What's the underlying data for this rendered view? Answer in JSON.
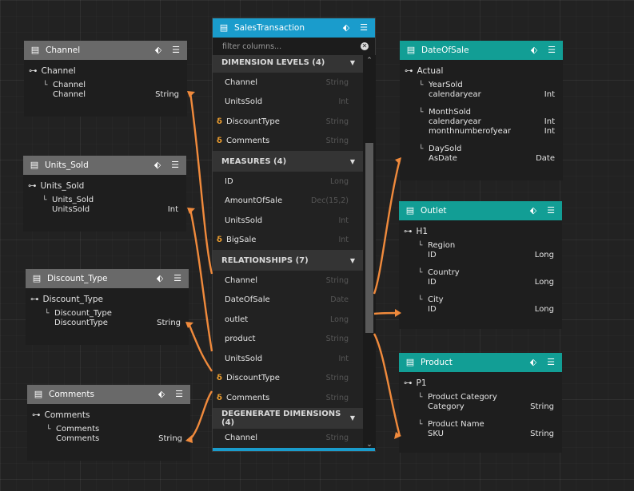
{
  "sales": {
    "title": "SalesTransaction",
    "filter_placeholder": "filter columns...",
    "sections": [
      {
        "title": "DIMENSION LEVELS (4)",
        "rows": [
          {
            "name": "Channel",
            "type": "String",
            "delta": false
          },
          {
            "name": "UnitsSold",
            "type": "Int",
            "delta": false
          },
          {
            "name": "DiscountType",
            "type": "String",
            "delta": true
          },
          {
            "name": "Comments",
            "type": "String",
            "delta": true
          }
        ]
      },
      {
        "title": "MEASURES (4)",
        "rows": [
          {
            "name": "ID",
            "type": "Long",
            "delta": false
          },
          {
            "name": "AmountOfSale",
            "type": "Dec(15,2)",
            "delta": false
          },
          {
            "name": "UnitsSold",
            "type": "Int",
            "delta": false
          },
          {
            "name": "BigSale",
            "type": "Int",
            "delta": true
          }
        ]
      },
      {
        "title": "RELATIONSHIPS (7)",
        "rows": [
          {
            "name": "Channel",
            "type": "String",
            "delta": false
          },
          {
            "name": "DateOfSale",
            "type": "Date",
            "delta": false
          },
          {
            "name": "outlet",
            "type": "Long",
            "delta": false
          },
          {
            "name": "product",
            "type": "String",
            "delta": false
          },
          {
            "name": "UnitsSold",
            "type": "Int",
            "delta": false
          },
          {
            "name": "DiscountType",
            "type": "String",
            "delta": true
          },
          {
            "name": "Comments",
            "type": "String",
            "delta": true
          }
        ]
      },
      {
        "title": "DEGENERATE DIMENSIONS (4)",
        "rows": [
          {
            "name": "Channel",
            "type": "String",
            "delta": false
          }
        ]
      }
    ]
  },
  "dims": [
    {
      "id": "channel",
      "title": "Channel",
      "hierarchy": "Channel",
      "levels": [
        {
          "names": [
            "Channel",
            "Channel"
          ],
          "types": [
            "",
            "String"
          ]
        }
      ]
    },
    {
      "id": "units",
      "title": "Units_Sold",
      "hierarchy": "Units_Sold",
      "levels": [
        {
          "names": [
            "Units_Sold",
            "UnitsSold"
          ],
          "types": [
            "",
            "Int"
          ]
        }
      ]
    },
    {
      "id": "discount",
      "title": "Discount_Type",
      "hierarchy": "Discount_Type",
      "levels": [
        {
          "names": [
            "Discount_Type",
            "DiscountType"
          ],
          "types": [
            "",
            "String"
          ]
        }
      ]
    },
    {
      "id": "comments",
      "title": "Comments",
      "hierarchy": "Comments",
      "levels": [
        {
          "names": [
            "Comments",
            "Comments"
          ],
          "types": [
            "",
            "String"
          ]
        }
      ]
    },
    {
      "id": "date",
      "title": "DateOfSale",
      "hierarchy": "Actual",
      "levels": [
        {
          "names": [
            "YearSold",
            "calendaryear"
          ],
          "types": [
            "",
            "Int"
          ]
        },
        {
          "names": [
            "MonthSold",
            "calendaryear",
            "monthnumberofyear"
          ],
          "types": [
            "",
            "Int",
            "Int"
          ]
        },
        {
          "names": [
            "DaySold",
            "AsDate"
          ],
          "types": [
            "",
            "Date"
          ]
        }
      ]
    },
    {
      "id": "outlet",
      "title": "Outlet",
      "hierarchy": "H1",
      "levels": [
        {
          "names": [
            "Region",
            "ID"
          ],
          "types": [
            "",
            "Long"
          ]
        },
        {
          "names": [
            "Country",
            "ID"
          ],
          "types": [
            "",
            "Long"
          ]
        },
        {
          "names": [
            "City",
            "ID"
          ],
          "types": [
            "",
            "Long"
          ]
        }
      ]
    },
    {
      "id": "product",
      "title": "Product",
      "hierarchy": "P1",
      "levels": [
        {
          "names": [
            "Product Category",
            "Category"
          ],
          "types": [
            "",
            "String"
          ]
        },
        {
          "names": [
            "Product Name",
            "SKU"
          ],
          "types": [
            "",
            "String"
          ]
        }
      ]
    }
  ],
  "colors": {
    "accent_blue": "#1a9ccc",
    "accent_teal": "#129e95",
    "header_gray": "#696969",
    "link": "#f08a3c",
    "delta": "#f0a030"
  },
  "icons": {
    "table": "table-icon",
    "hierarchy": "hierarchy-icon",
    "level": "level-corner-icon",
    "menu": "hamburger-menu-icon",
    "delta": "delta-icon"
  }
}
